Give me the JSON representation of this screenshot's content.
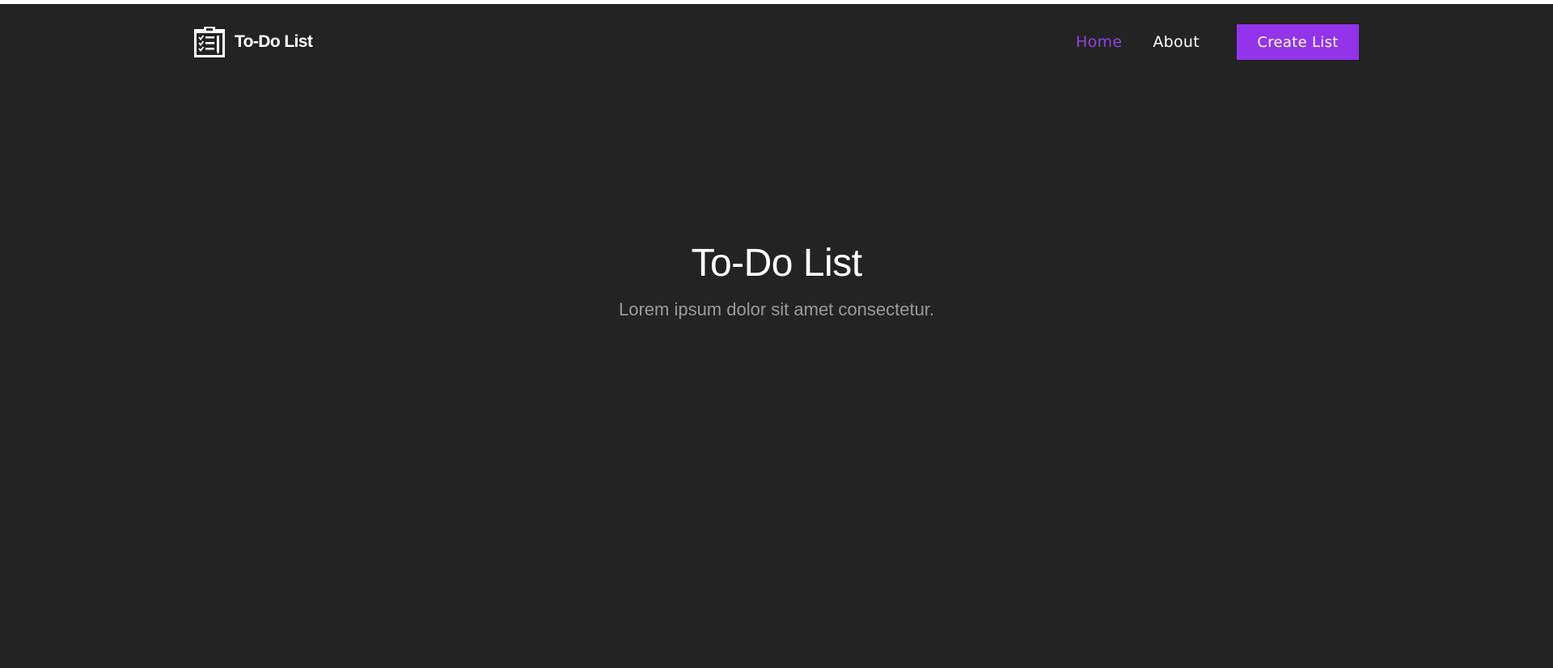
{
  "navbar": {
    "brand_name": "To-Do List",
    "brand_icon": "clipboard-checklist-icon",
    "links": [
      {
        "label": "Home",
        "active": true
      },
      {
        "label": "About",
        "active": false
      }
    ],
    "cta_label": "Create List"
  },
  "hero": {
    "title": "To-Do List",
    "subtitle": "Lorem ipsum dolor sit amet consectetur."
  },
  "colors": {
    "background": "#232323",
    "accent": "#9333ea",
    "active_link": "#8e44de",
    "text": "#ffffff",
    "muted_text": "#9a9a9a"
  }
}
